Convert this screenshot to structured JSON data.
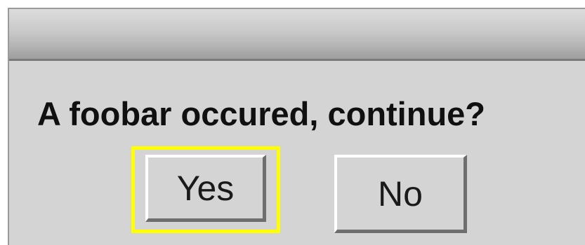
{
  "dialog": {
    "title": "",
    "message": "A foobar occured, continue?",
    "buttons": {
      "yes_label": "Yes",
      "no_label": "No"
    },
    "focused_button": "yes"
  },
  "colors": {
    "dialog_background": "#d4d4d4",
    "focus_ring": "#ffff00",
    "text": "#101010"
  }
}
